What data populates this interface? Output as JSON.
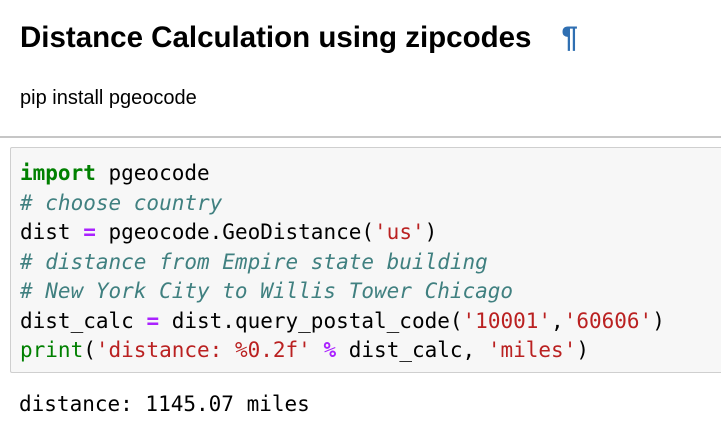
{
  "markdown_cell": {
    "heading": "Distance Calculation using zipcodes",
    "anchor_symbol": "¶",
    "paragraph": "pip install pgeocode"
  },
  "code_cell": {
    "lines": [
      [
        {
          "type": "keyword",
          "text": "import"
        },
        {
          "type": "name",
          "text": " pgeocode"
        }
      ],
      [
        {
          "type": "comment",
          "text": "# choose country"
        }
      ],
      [
        {
          "type": "name",
          "text": "dist "
        },
        {
          "type": "operator",
          "text": "="
        },
        {
          "type": "name",
          "text": " pgeocode.GeoDistance("
        },
        {
          "type": "string",
          "text": "'us'"
        },
        {
          "type": "name",
          "text": ")"
        }
      ],
      [
        {
          "type": "comment",
          "text": "# distance from Empire state building"
        }
      ],
      [
        {
          "type": "comment",
          "text": "# New York City to Willis Tower Chicago"
        }
      ],
      [
        {
          "type": "name",
          "text": "dist_calc "
        },
        {
          "type": "operator",
          "text": "="
        },
        {
          "type": "name",
          "text": " dist.query_postal_code("
        },
        {
          "type": "string",
          "text": "'10001'"
        },
        {
          "type": "name",
          "text": ","
        },
        {
          "type": "string",
          "text": "'60606'"
        },
        {
          "type": "name",
          "text": ")"
        }
      ],
      [
        {
          "type": "builtin",
          "text": "print"
        },
        {
          "type": "name",
          "text": "("
        },
        {
          "type": "string",
          "text": "'distance: %0.2f'"
        },
        {
          "type": "name",
          "text": " "
        },
        {
          "type": "operator",
          "text": "%"
        },
        {
          "type": "name",
          "text": " dist_calc, "
        },
        {
          "type": "string",
          "text": "'miles'"
        },
        {
          "type": "name",
          "text": ")"
        }
      ]
    ],
    "output": "distance: 1145.07 miles"
  },
  "colors": {
    "anchor": "#2f6fb2",
    "keyword": "#008000",
    "comment": "#408080",
    "string": "#ba2121",
    "operator": "#aa22ff",
    "code_background": "#f7f7f7",
    "code_border": "#cfcfcf",
    "divider": "#c6c6c6"
  }
}
